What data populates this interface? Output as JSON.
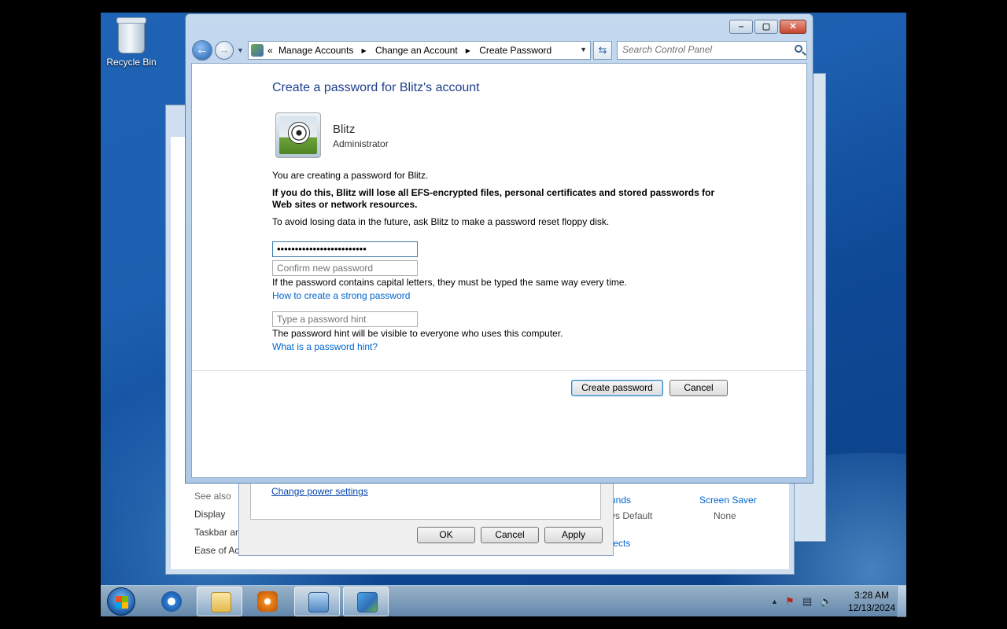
{
  "desktop": {
    "recycle_bin_label": "Recycle Bin"
  },
  "window": {
    "address": {
      "overflow": "«",
      "crumbs": [
        "Manage Accounts",
        "Change an Account",
        "Create Password"
      ]
    },
    "search_placeholder": "Search Control Panel",
    "buttons": {
      "minimize": "‒",
      "maximize": "▢",
      "close": "✕"
    }
  },
  "page": {
    "heading": "Create a password for Blitz's account",
    "user": {
      "name": "Blitz",
      "role": "Administrator"
    },
    "intro": "You are creating a password for Blitz.",
    "warning": "If you do this, Blitz will lose all EFS-encrypted files, personal certificates and stored passwords for Web sites or network resources.",
    "floppy_note": "To avoid losing data in the future, ask Blitz to make a password reset floppy disk.",
    "new_password_value": "•••••••••••••••••••••••••",
    "confirm_placeholder": "Confirm new password",
    "caps_note": "If the password contains capital letters, they must be typed the same way every time.",
    "strong_link": "How to create a strong password",
    "hint_placeholder": "Type a password hint",
    "hint_note": "The password hint will be visible to everyone who uses this computer.",
    "hint_link": "What is a password hint?",
    "create_button": "Create password",
    "cancel_button": "Cancel"
  },
  "background": {
    "see_also": "See also",
    "links": [
      "Display",
      "Taskbar an",
      "Ease of Acc"
    ],
    "change_power": "Change power settings",
    "ok": "OK",
    "cancel": "Cancel",
    "apply": "Apply",
    "sounds": "unds",
    "windows_default": "vs Default",
    "effects": "fects",
    "screen_saver": "Screen Saver",
    "screen_saver_value": "None"
  },
  "taskbar": {
    "time": "3:28 AM",
    "date": "12/13/2024",
    "tray_arrow": "▲"
  }
}
